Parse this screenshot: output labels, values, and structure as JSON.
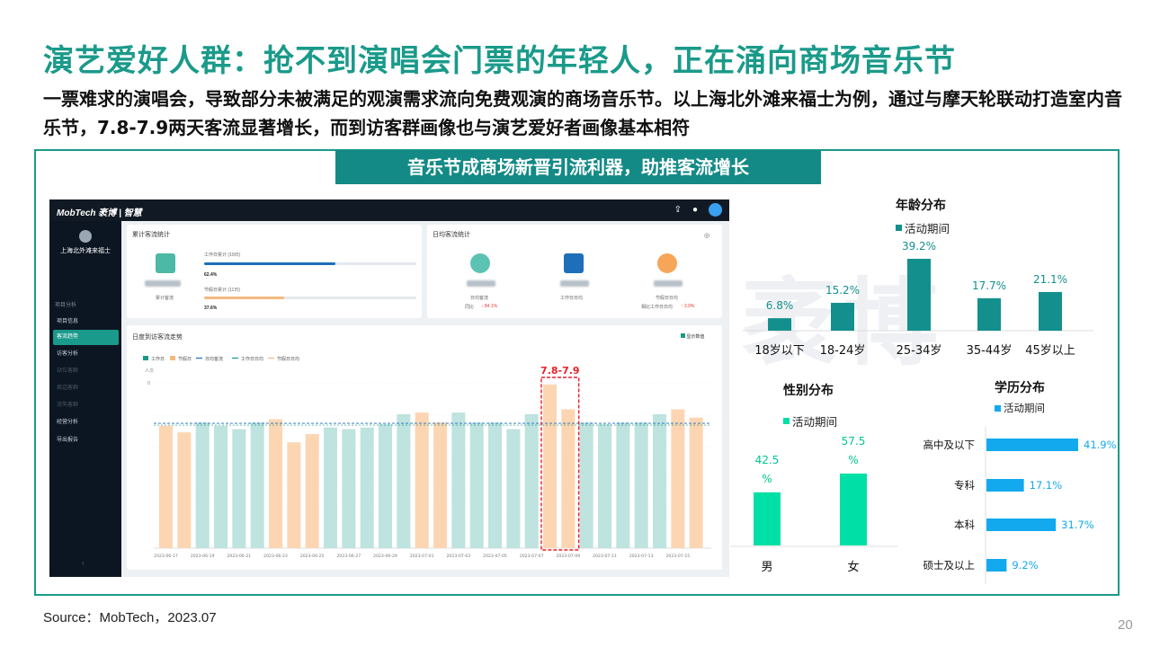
{
  "slide": {
    "title": "演艺爱好人群：抢不到演唱会门票的年轻人，正在涌向商场音乐节",
    "subtitle": "一票难求的演唱会，导致部分未被满足的观演需求流向免费观演的商场音乐节。以上海北外滩来福士为例，通过与摩天轮联动打造室内音乐节，7.8-7.9两天客流显著增长，而到访客群画像也与演艺爱好者画像基本相符",
    "banner": "音乐节成商场新晋引流利器，助推客流增长",
    "source": "Source：MobTech，2023.07",
    "page_number": "20",
    "watermark": "袤博"
  },
  "screenshot": {
    "app_logo": "MobTech 袤博 | 智慧",
    "mall_name": "上海北外滩来福士",
    "sidebar_group": "项目分析",
    "sidebar_items": [
      "项目信息",
      "客流趋势",
      "访客分析",
      "站位客群",
      "周边客群",
      "流失客群",
      "经营分析",
      "导出报告"
    ],
    "card1_title": "累计客流统计",
    "card1_kpi_label": "累计客流",
    "workday_label": "工作日累计 (19日)",
    "workday_pct": "62.4%",
    "holiday_label": "节假日累计 (11日)",
    "holiday_pct": "37.6%",
    "workday_share": 0.624,
    "holiday_share": 0.376,
    "card2_title": "日均客流统计",
    "daily_label": "日均客流",
    "daily_change_label": "同比",
    "daily_change": "↓ 84.1%",
    "workday_avg_label": "工作日日均",
    "holiday_avg_label": "节假日日均",
    "holiday_avg_change_label": "相比工作日日均",
    "holiday_avg_change": "↑ 3.9%",
    "trend_title": "日度到访客流走势",
    "show_values_label": "显示数值",
    "trend_legend": [
      "工作日",
      "节假日",
      "日均客流",
      "工作日日均",
      "节假日日均"
    ],
    "y_unit": "人次",
    "y_zero": "0",
    "highlight_label": "7.8-7.9"
  },
  "colors": {
    "teal": "#1a9a8a",
    "banner": "#138a85",
    "age_bar": "#13908d",
    "gender_bar": "#00e0a6",
    "edu_bar": "#12a9ee",
    "workday_bar": "#bfe3df",
    "holiday_bar": "#fcd6b3",
    "highlight": "#e8202a"
  },
  "chart_data": [
    {
      "type": "bar",
      "title": "年龄分布",
      "legend": [
        "活动期间"
      ],
      "categories": [
        "18岁以下",
        "18-24岁",
        "25-34岁",
        "35-44岁",
        "45岁以上"
      ],
      "values": [
        6.8,
        15.2,
        39.2,
        17.7,
        21.1
      ],
      "labels": [
        "6.8%",
        "15.2%",
        "39.2%",
        "17.7%",
        "21.1%"
      ],
      "unit": "%"
    },
    {
      "type": "bar",
      "title": "性别分布",
      "legend": [
        "活动期间"
      ],
      "categories": [
        "男",
        "女"
      ],
      "values": [
        42.5,
        57.5
      ],
      "labels": [
        [
          "42.5",
          "%"
        ],
        [
          "57.5",
          "%"
        ]
      ],
      "unit": "%"
    },
    {
      "type": "bar",
      "orientation": "horizontal",
      "title": "学历分布",
      "legend": [
        "活动期间"
      ],
      "categories": [
        "高中及以下",
        "专科",
        "本科",
        "硕士及以上"
      ],
      "values": [
        41.9,
        17.1,
        31.7,
        9.2
      ],
      "labels": [
        "41.9%",
        "17.1%",
        "31.7%",
        "9.2%"
      ],
      "unit": "%"
    },
    {
      "type": "bar",
      "title": "日度到访客流走势",
      "x_tick_labels": [
        "2023-06-17",
        "2023-06-19",
        "2023-06-21",
        "2023-06-23",
        "2023-06-25",
        "2023-06-27",
        "2023-06-29",
        "2023-07-01",
        "2023-07-03",
        "2023-07-05",
        "2023-07-07",
        "2023-07-09",
        "2023-07-11",
        "2023-07-13",
        "2023-07-15"
      ],
      "day_types": [
        "h",
        "h",
        "w",
        "w",
        "w",
        "w",
        "h",
        "h",
        "h",
        "w",
        "w",
        "w",
        "w",
        "w",
        "h",
        "h",
        "w",
        "w",
        "w",
        "w",
        "w",
        "h",
        "h",
        "w",
        "w",
        "w",
        "w",
        "w",
        "h",
        "h"
      ],
      "values": [
        0.74,
        0.7,
        0.76,
        0.74,
        0.72,
        0.76,
        0.78,
        0.64,
        0.69,
        0.73,
        0.72,
        0.73,
        0.75,
        0.81,
        0.82,
        0.76,
        0.82,
        0.76,
        0.76,
        0.72,
        0.81,
        0.99,
        0.84,
        0.76,
        0.75,
        0.76,
        0.76,
        0.81,
        0.84,
        0.79
      ],
      "avg_line": 0.755,
      "highlight_range": [
        21,
        22
      ]
    }
  ]
}
